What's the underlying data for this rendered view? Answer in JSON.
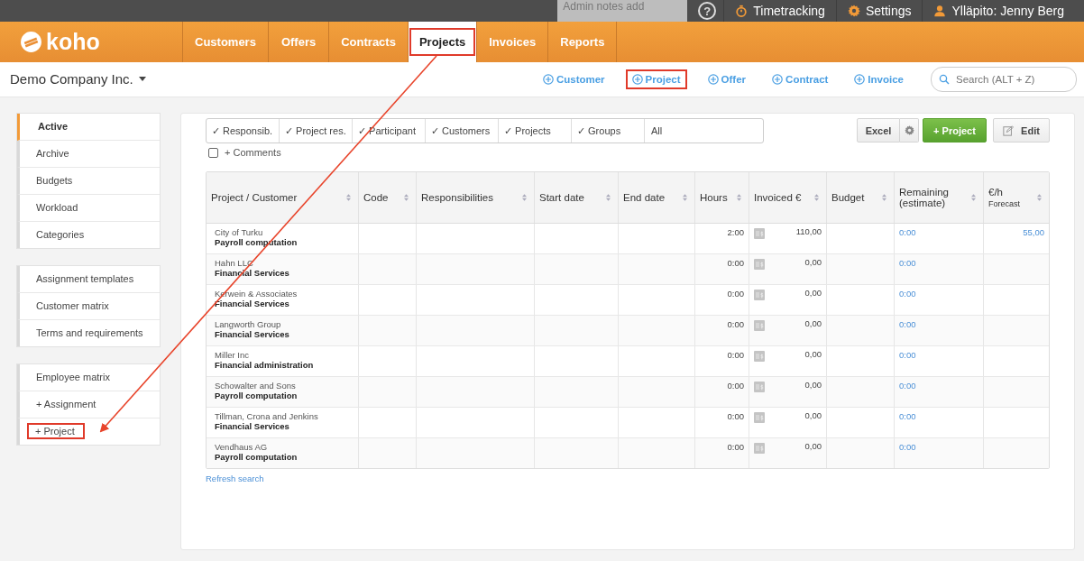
{
  "top_bar": {
    "notes_placeholder": "Admin notes add",
    "help": "?",
    "links": [
      {
        "kind": "timer",
        "label": "Timetracking"
      },
      {
        "kind": "gear",
        "label": "Settings"
      },
      {
        "kind": "user",
        "label": "Ylläpito: Jenny Berg"
      }
    ]
  },
  "logo": "koho",
  "nav": [
    {
      "label": "Customers",
      "selected": false,
      "highlighted": false
    },
    {
      "label": "Offers",
      "selected": false,
      "highlighted": false
    },
    {
      "label": "Contracts",
      "selected": false,
      "highlighted": false
    },
    {
      "label": "Projects",
      "selected": true,
      "highlighted": true
    },
    {
      "label": "Invoices",
      "selected": false,
      "highlighted": false
    },
    {
      "label": "Reports",
      "selected": false,
      "highlighted": false
    }
  ],
  "company": "Demo Company Inc.",
  "quick_add": [
    {
      "label": "Customer",
      "highlighted": false
    },
    {
      "label": "Project",
      "highlighted": true
    },
    {
      "label": "Offer",
      "highlighted": false
    },
    {
      "label": "Contract",
      "highlighted": false
    },
    {
      "label": "Invoice",
      "highlighted": false
    }
  ],
  "search": {
    "placeholder": "Search (ALT + Z)"
  },
  "sidebar": [
    [
      {
        "label": "Active",
        "selected": true,
        "highlighted": false
      },
      {
        "label": "Archive",
        "selected": false,
        "highlighted": false
      },
      {
        "label": "Budgets",
        "selected": false,
        "highlighted": false
      },
      {
        "label": "Workload",
        "selected": false,
        "highlighted": false
      },
      {
        "label": "Categories",
        "selected": false,
        "highlighted": false
      }
    ],
    [
      {
        "label": "Assignment templates",
        "selected": false,
        "highlighted": false
      },
      {
        "label": "Customer matrix",
        "selected": false,
        "highlighted": false
      },
      {
        "label": "Terms and requirements",
        "selected": false,
        "highlighted": false
      }
    ],
    [
      {
        "label": "Employee matrix",
        "selected": false,
        "highlighted": false
      },
      {
        "label": "+ Assignment",
        "selected": false,
        "highlighted": false
      },
      {
        "label": "+ Project",
        "selected": false,
        "highlighted": true
      }
    ]
  ],
  "filters": [
    "✓ Responsib.",
    "✓ Project res.",
    "✓ Participant",
    "✓ Customers",
    "✓ Projects",
    "✓ Groups"
  ],
  "filter_value": "All",
  "comments": {
    "label": "+ Comments",
    "checked": false
  },
  "toolbar": {
    "excel": "Excel",
    "add": "+ Project",
    "edit": "Edit"
  },
  "table": {
    "columns": [
      {
        "label": "Project / Customer"
      },
      {
        "label": "Code"
      },
      {
        "label": "Responsibilities"
      },
      {
        "label": "Start date"
      },
      {
        "label": "End date"
      },
      {
        "label": "Hours"
      },
      {
        "label": "Invoiced €"
      },
      {
        "label": "Budget"
      },
      {
        "label": "Remaining (estimate)"
      },
      {
        "label": "€/h",
        "sublabel": "Forecast"
      }
    ],
    "rows": [
      {
        "customer": "City of Turku",
        "project": "Payroll computation",
        "hours": "2:00",
        "invoiced": "110,00",
        "remaining": "0:00",
        "eur_per_h": "55,00"
      },
      {
        "customer": "Hahn LLC",
        "project": "Financial Services",
        "hours": "0:00",
        "invoiced": "0,00",
        "remaining": "0:00"
      },
      {
        "customer": "Kerwein & Associates",
        "project": "Financial Services",
        "hours": "0:00",
        "invoiced": "0,00",
        "remaining": "0:00"
      },
      {
        "customer": "Langworth Group",
        "project": "Financial Services",
        "hours": "0:00",
        "invoiced": "0,00",
        "remaining": "0:00"
      },
      {
        "customer": "Miller Inc",
        "project": "Financial administration",
        "hours": "0:00",
        "invoiced": "0,00",
        "remaining": "0:00"
      },
      {
        "customer": "Schowalter and Sons",
        "project": "Payroll computation",
        "hours": "0:00",
        "invoiced": "0,00",
        "remaining": "0:00"
      },
      {
        "customer": "Tillman, Crona and Jenkins",
        "project": "Financial Services",
        "hours": "0:00",
        "invoiced": "0,00",
        "remaining": "0:00"
      },
      {
        "customer": "Vendhaus AG",
        "project": "Payroll computation",
        "hours": "0:00",
        "invoiced": "0,00",
        "remaining": "0:00"
      }
    ]
  },
  "refresh": "Refresh search"
}
